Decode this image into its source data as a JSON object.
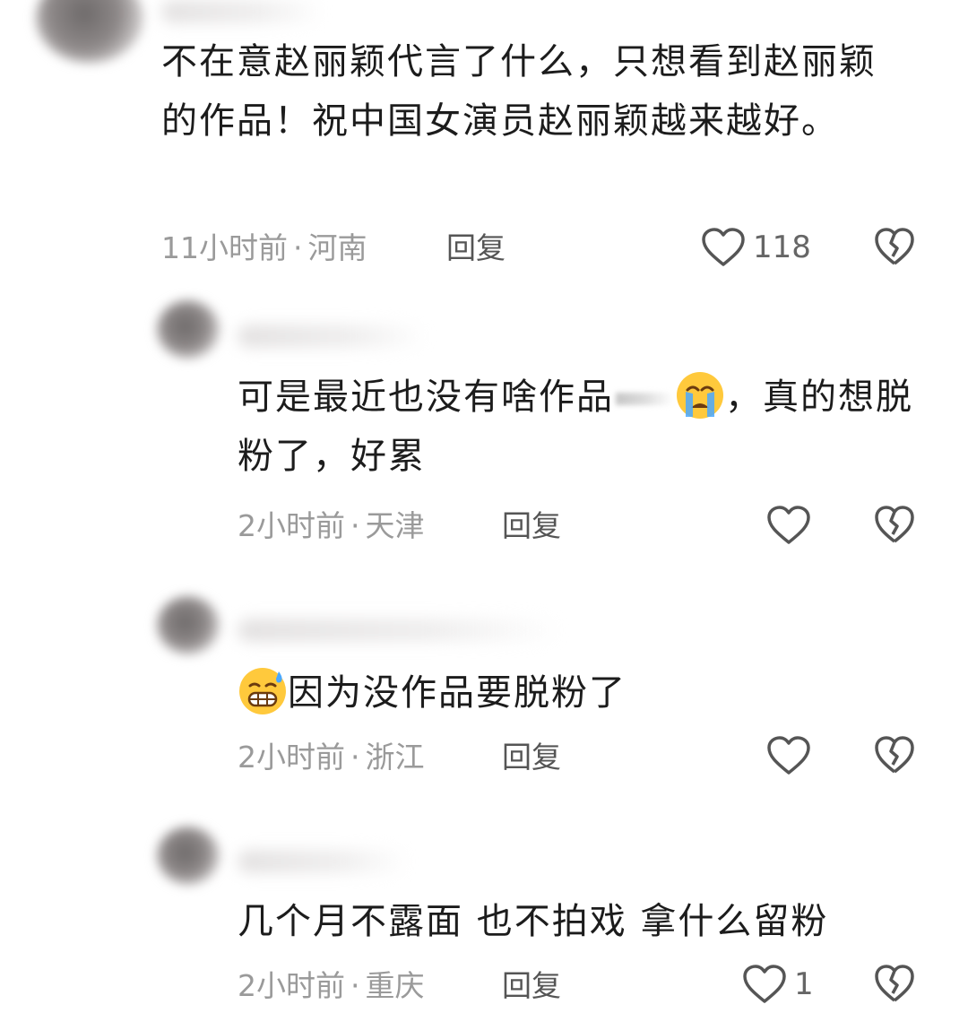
{
  "colors": {
    "text": "#1c1c1c",
    "meta": "#9a9a9a",
    "icon": "#555555"
  },
  "comments": [
    {
      "text": "不在意赵丽颖代言了什么，只想看到赵丽颖的作品！祝中国女演员赵丽颖越来越好。",
      "time": "11小时前",
      "location": "河南",
      "reply_label": "回复",
      "likes": "118",
      "like_icon": "heart-outline-icon",
      "dislike_icon": "broken-heart-icon"
    },
    {
      "text_before": "可是最近也没有啥作品",
      "emoji": "crying-face-emoji",
      "text_after": "，真的想脱粉了，好累",
      "time": "2小时前",
      "location": "天津",
      "reply_label": "回复",
      "likes": "",
      "like_icon": "heart-outline-icon",
      "dislike_icon": "broken-heart-icon"
    },
    {
      "emoji": "grinning-sweat-emoji",
      "text": "因为没作品要脱粉了",
      "time": "2小时前",
      "location": "浙江",
      "reply_label": "回复",
      "likes": "",
      "like_icon": "heart-outline-icon",
      "dislike_icon": "broken-heart-icon"
    },
    {
      "text": "几个月不露面 也不拍戏 拿什么留粉",
      "time": "2小时前",
      "location": "重庆",
      "reply_label": "回复",
      "likes": "1",
      "like_icon": "heart-outline-icon",
      "dislike_icon": "broken-heart-icon"
    }
  ],
  "separator": "·"
}
